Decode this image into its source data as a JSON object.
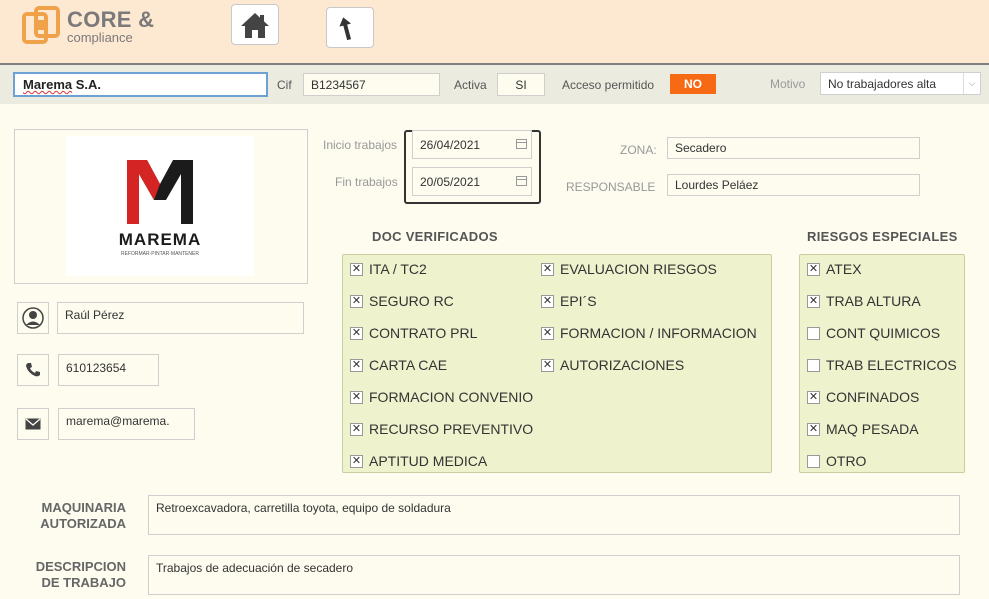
{
  "header": {
    "logo_title": "CORE &",
    "logo_subtitle": "compliance"
  },
  "company": {
    "name_underlined": "Marema",
    "name_rest": " S.A.",
    "cif_label": "Cif",
    "cif_value": "B1234567",
    "activa_label": "Activa",
    "activa_value": "SI",
    "acceso_label": "Acceso permitido",
    "acceso_value": "NO",
    "motivo_label": "Motivo",
    "motivo_value": "No trabajadores alta"
  },
  "logo": {
    "brand": "MAREMA",
    "tagline": "REFORMAR·PINTAR·MANTENER"
  },
  "contact": {
    "name": "Raúl Pérez",
    "phone": "610123654",
    "email": "marema@marema."
  },
  "dates": {
    "start_label": "Inicio trabajos",
    "start_value": "26/04/2021",
    "end_label": "Fin trabajos",
    "end_value": "20/05/2021"
  },
  "zone": {
    "zona_label": "ZONA:",
    "zona_value": "Secadero",
    "resp_label": "RESPONSABLE",
    "resp_value": "Lourdes Peláez"
  },
  "doc_verificados": {
    "title": "DOC VERIFICADOS",
    "col1": [
      {
        "label": "ITA / TC2",
        "checked": true
      },
      {
        "label": "SEGURO RC",
        "checked": true
      },
      {
        "label": "CONTRATO PRL",
        "checked": true
      },
      {
        "label": "CARTA CAE",
        "checked": true
      },
      {
        "label": "FORMACION CONVENIO",
        "checked": true
      },
      {
        "label": "RECURSO PREVENTIVO",
        "checked": true
      },
      {
        "label": "APTITUD MEDICA",
        "checked": true
      }
    ],
    "col2": [
      {
        "label": "EVALUACION RIESGOS",
        "checked": true
      },
      {
        "label": "EPI´S",
        "checked": true
      },
      {
        "label": "FORMACION / INFORMACION",
        "checked": true
      },
      {
        "label": "AUTORIZACIONES",
        "checked": true
      }
    ]
  },
  "riesgos": {
    "title": "RIESGOS ESPECIALES",
    "items": [
      {
        "label": "ATEX",
        "checked": true
      },
      {
        "label": "TRAB ALTURA",
        "checked": true
      },
      {
        "label": "CONT QUIMICOS",
        "checked": false
      },
      {
        "label": "TRAB ELECTRICOS",
        "checked": false
      },
      {
        "label": "CONFINADOS",
        "checked": true
      },
      {
        "label": "MAQ PESADA",
        "checked": true
      },
      {
        "label": "OTRO",
        "checked": false
      }
    ]
  },
  "maquinaria": {
    "label_line1": "MAQUINARIA",
    "label_line2": "AUTORIZADA",
    "value": "Retroexcavadora, carretilla toyota, equipo de soldadura"
  },
  "descripcion": {
    "label_line1": "DESCRIPCION",
    "label_line2": "DE TRABAJO",
    "value": "Trabajos de adecuación de secadero"
  },
  "colors": {
    "header_bg": "#fde8d2",
    "accent_orange": "#f66a14",
    "panel_green": "#eef2cd",
    "logo_red": "#d42424"
  },
  "icons": [
    "home-icon",
    "back-arrow-icon",
    "user-icon",
    "phone-icon",
    "mail-icon",
    "calendar-icon",
    "chevron-down-icon"
  ]
}
